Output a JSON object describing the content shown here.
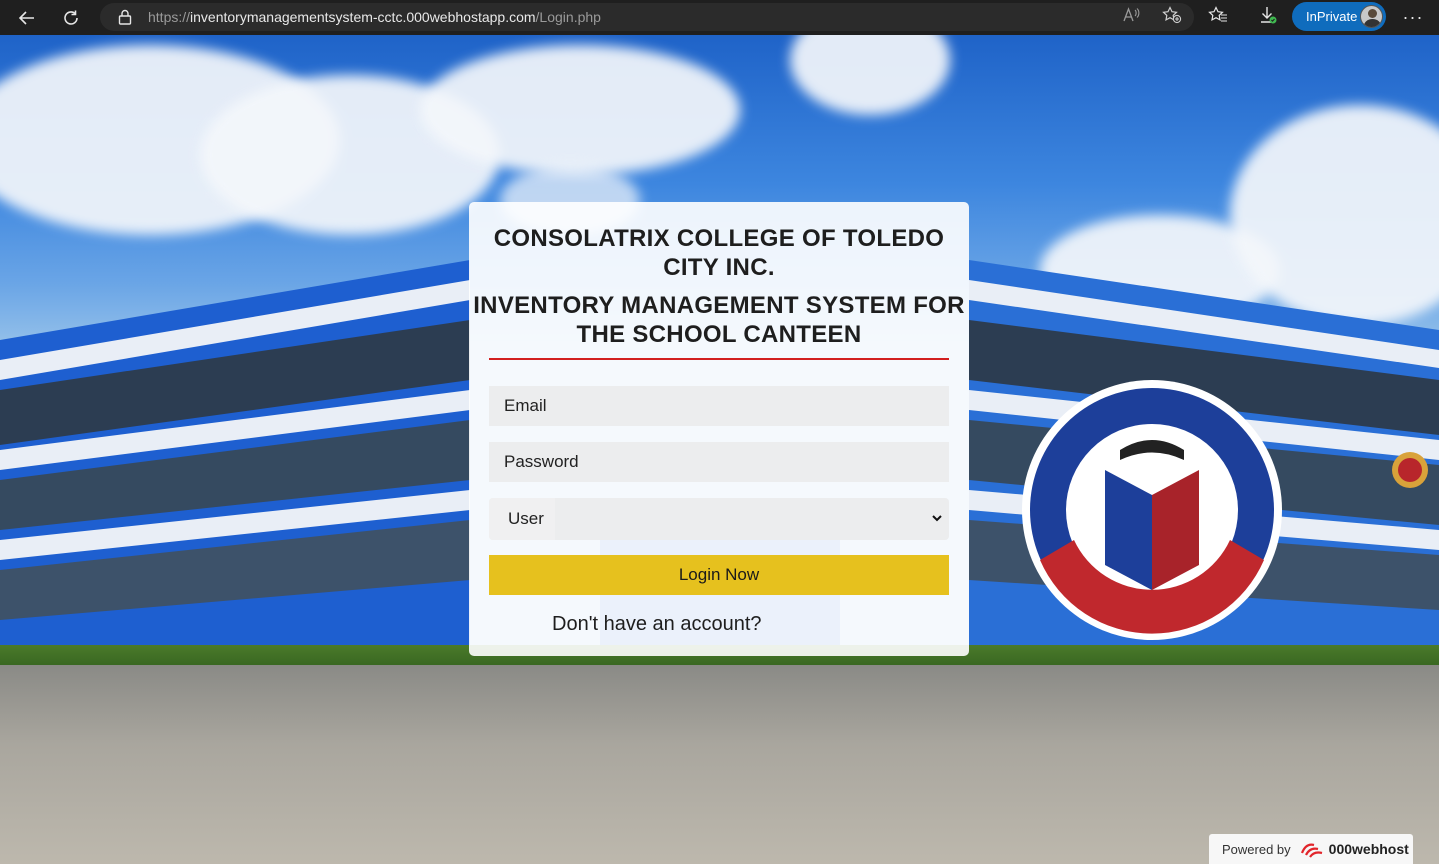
{
  "browser": {
    "url_scheme": "https://",
    "url_host": "inventorymanagementsystem-cctc.000webhostapp.com",
    "url_path": "/Login.php",
    "inprivate_label": "InPrivate"
  },
  "login": {
    "title": "CONSOLATRIX COLLEGE OF TOLEDO CITY INC.",
    "subtitle": "INVENTORY MANAGEMENT SYSTEM FOR THE SCHOOL CANTEEN",
    "email_placeholder": "Email",
    "password_placeholder": "Password",
    "user_type_selected": "User",
    "login_button": "Login Now",
    "signup_link": "Don't have an account?"
  },
  "footer": {
    "powered_by": "Powered by",
    "brand": "000webhost"
  },
  "colors": {
    "accent_yellow": "#e6c11e",
    "divider_red": "#d21f1f",
    "inprivate_blue": "#0f6cbd"
  }
}
